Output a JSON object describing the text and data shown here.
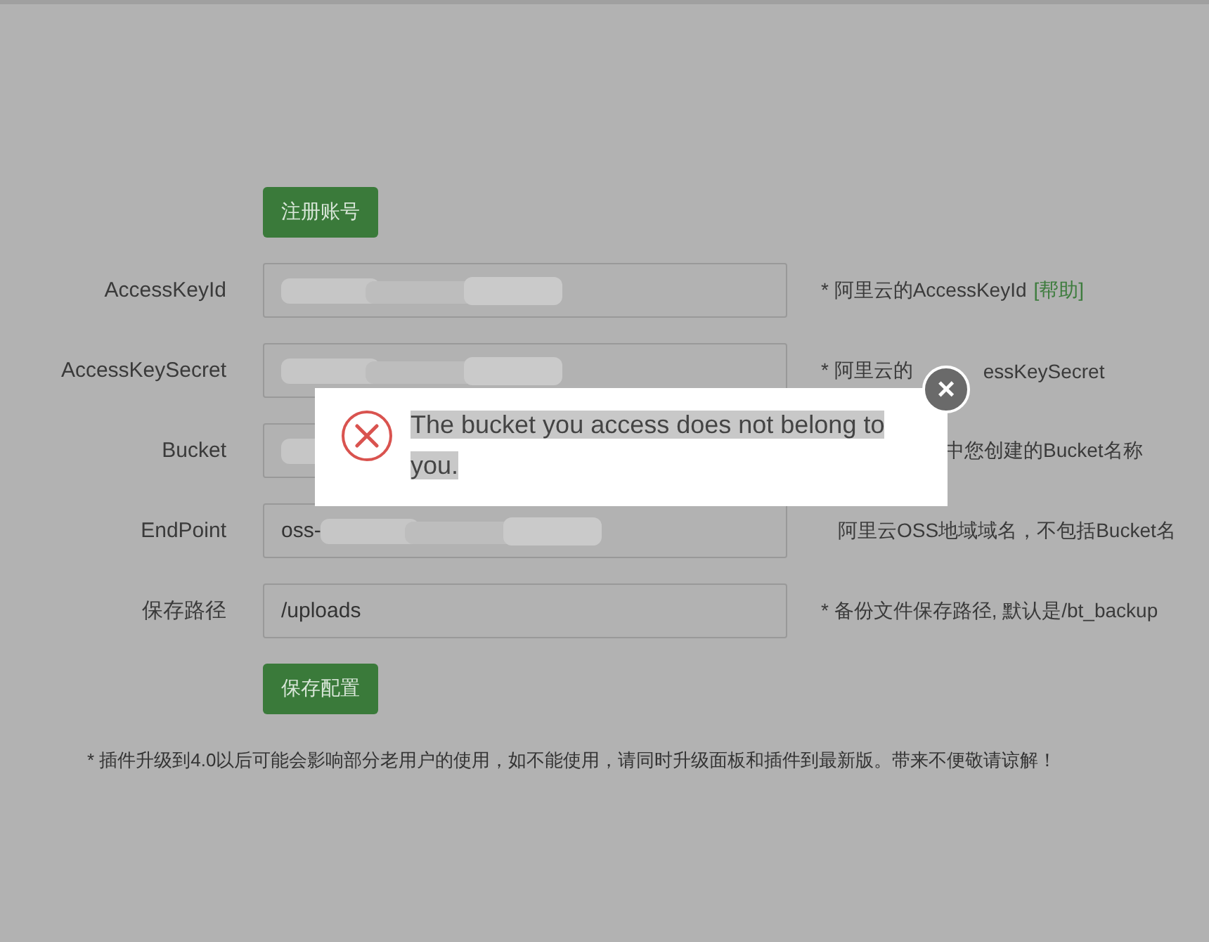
{
  "register_button": "注册账号",
  "fields": [
    {
      "label": "AccessKeyId",
      "blurred": true,
      "hint": [
        {
          "kind": "text",
          "text": "* 阿里云的AccessKeyId"
        },
        {
          "kind": "link",
          "text": "[帮助]"
        }
      ]
    },
    {
      "label": "AccessKeySecret",
      "blurred": true,
      "hint": [
        {
          "kind": "text",
          "text": "* 阿里云的"
        },
        {
          "kind": "gap"
        },
        {
          "kind": "text",
          "text": "essKeySecret"
        }
      ]
    },
    {
      "label": "Bucket",
      "blurred": true,
      "hint": [
        {
          "kind": "gap-wide"
        },
        {
          "kind": "text",
          "text": "中您创建的Bucket名称"
        }
      ]
    },
    {
      "label": "EndPoint",
      "value": "oss-",
      "blurred": true,
      "hint": [
        {
          "kind": "gap-small"
        },
        {
          "kind": "text",
          "text": "阿里云OSS地域域名，不包括Bucket名"
        }
      ]
    },
    {
      "label": "保存路径",
      "value": "/uploads",
      "blurred": false,
      "hint": [
        {
          "kind": "text",
          "text": "* 备份文件保存路径, 默认是/bt_backup"
        }
      ]
    }
  ],
  "save_button": "保存配置",
  "footnote": "* 插件升级到4.0以后可能会影响部分老用户的使用，如不能使用，请同时升级面板和插件到最新版。带来不便敬请谅解！",
  "dialog": {
    "message": "The bucket you access does not belong to you.",
    "message_selected": true,
    "close": "×"
  }
}
